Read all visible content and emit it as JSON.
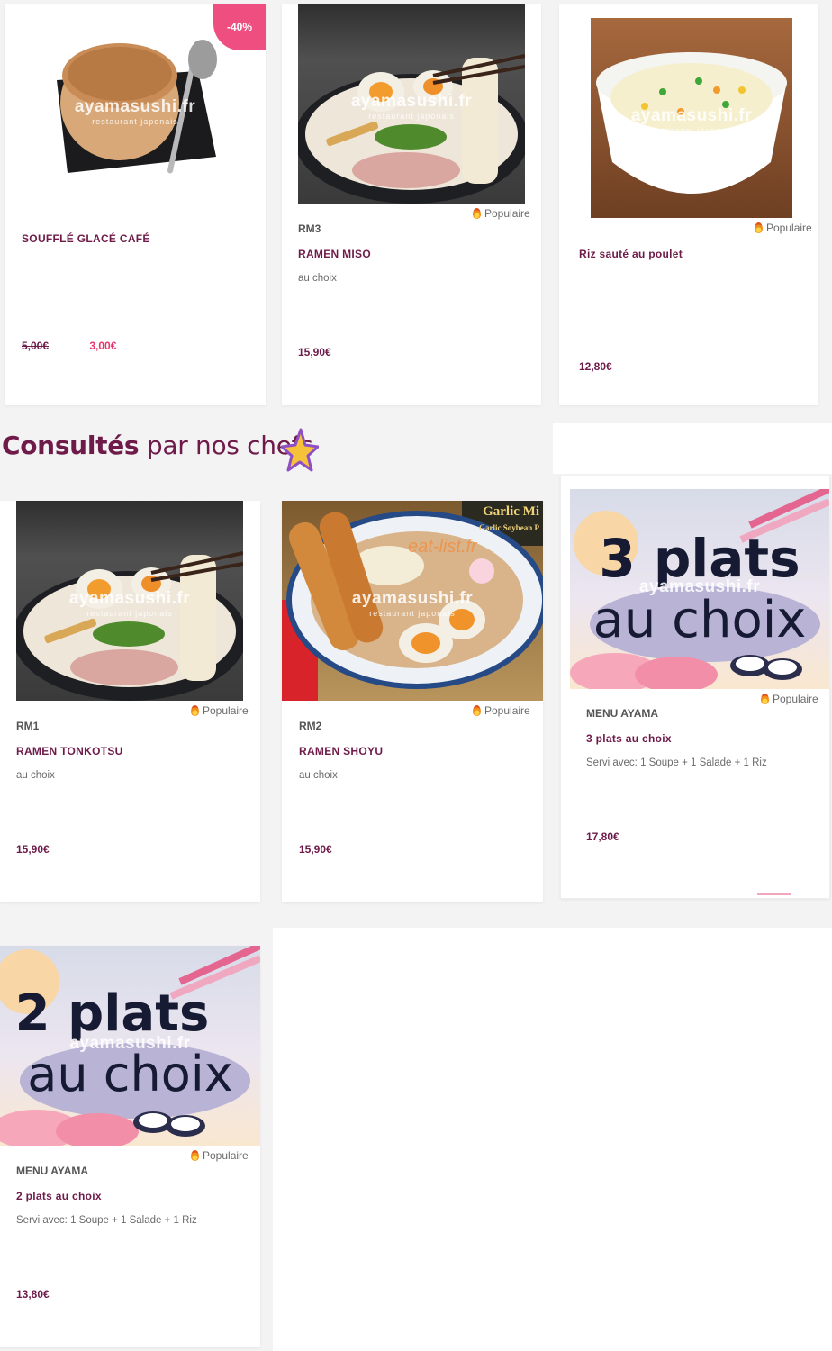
{
  "watermark": {
    "brand": "ayamasushi.fr",
    "sub": "restaurant japonais"
  },
  "popular_label": "Populaire",
  "colors": {
    "accent": "#6e1b4a",
    "discount": "#ee4e80",
    "promo_price": "#e8356b"
  },
  "row1": [
    {
      "badge": "-40%",
      "name": "SOUFFLÉ GLACÉ CAFÉ",
      "old_price": "5,00€",
      "price": "3,00€"
    },
    {
      "code": "RM3",
      "name": "RAMEN MISO",
      "desc": "au choix",
      "price": "15,90€"
    },
    {
      "name": "Riz sauté au poulet",
      "price": "12,80€"
    }
  ],
  "section": {
    "title_bold": "Consultés",
    "title_rest": "par nos chefs"
  },
  "row2": [
    {
      "code": "RM1",
      "name": "RAMEN TONKOTSU",
      "desc": "au choix",
      "price": "15,90€"
    },
    {
      "code": "RM2",
      "name": "RAMEN SHOYU",
      "desc": "au choix",
      "price": "15,90€",
      "image_extra": {
        "package": "Garlic Mi",
        "package_sub": "Garlic Soybean P",
        "watermark2": "eat-list.fr"
      }
    },
    {
      "image_line1": "3 plats",
      "image_line2": "au choix",
      "code": "MENU AYAMA",
      "name": "3 plats au choix",
      "desc": "Servi avec: 1 Soupe + 1 Salade + 1 Riz",
      "price": "17,80€"
    }
  ],
  "row3": [
    {
      "image_line1": "2 plats",
      "image_line2": "au choix",
      "code": "MENU AYAMA",
      "name": "2 plats au choix",
      "desc": "Servi avec: 1 Soupe + 1 Salade + 1 Riz",
      "price": "13,80€"
    }
  ]
}
